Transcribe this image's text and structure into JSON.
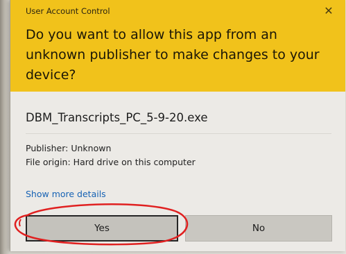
{
  "window": {
    "title": "User Account Control",
    "close_glyph": "✕"
  },
  "prompt": {
    "question": "Do you want to allow this app from an unknown publisher to make changes to your device?"
  },
  "app": {
    "filename": "DBM_Transcripts_PC_5-9-20.exe",
    "publisher": "Publisher: Unknown",
    "origin": "File origin: Hard drive on this computer"
  },
  "links": {
    "show_more": "Show more details"
  },
  "buttons": {
    "yes": "Yes",
    "no": "No"
  },
  "colors": {
    "header_bg": "#f1c21b",
    "link": "#1662b4",
    "annotation_circle": "#e02020"
  },
  "icons": {
    "close": "close-icon"
  }
}
